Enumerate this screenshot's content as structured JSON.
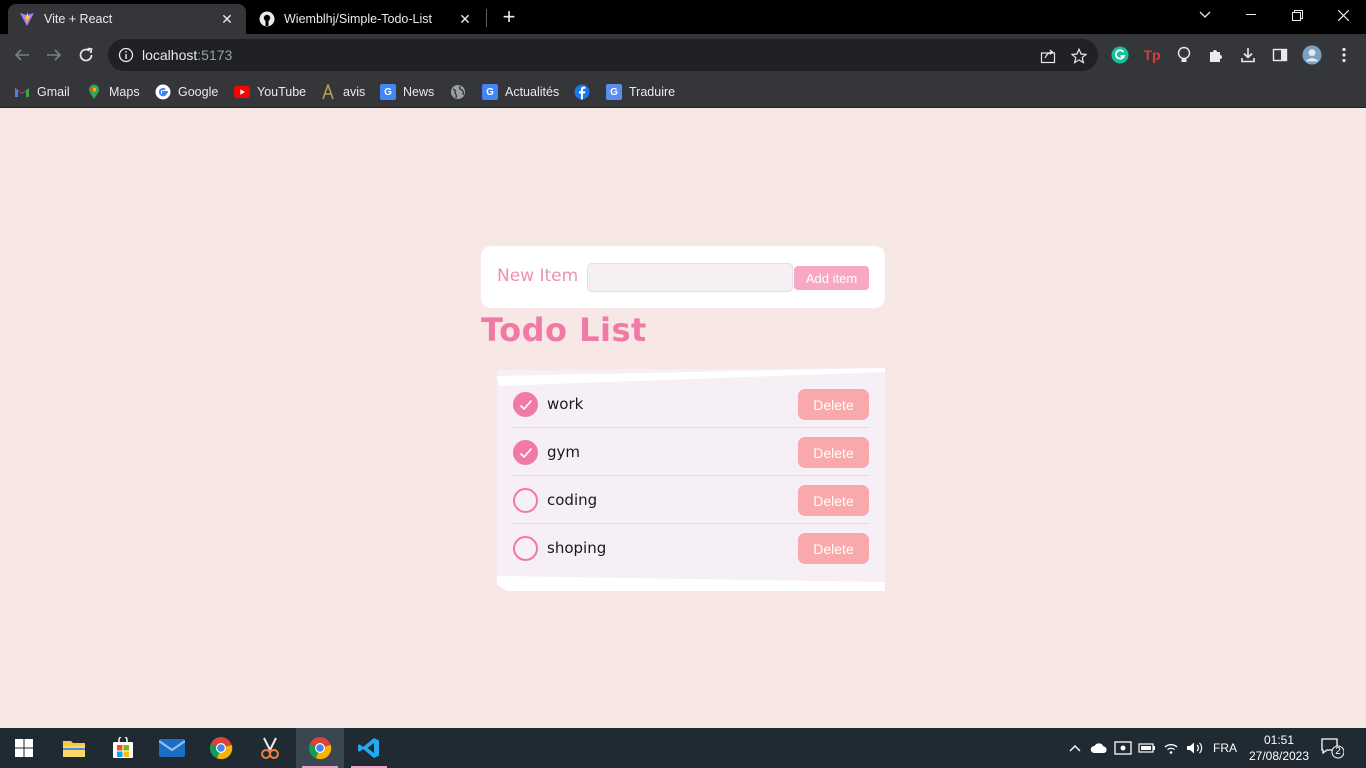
{
  "browser": {
    "tabs": [
      {
        "title": "Vite + React",
        "active": true
      },
      {
        "title": "Wiemblhj/Simple-Todo-List",
        "active": false
      }
    ],
    "url_host": "localhost",
    "url_port": ":5173",
    "bookmarks": [
      {
        "label": "Gmail",
        "icon": "gmail-icon"
      },
      {
        "label": "Maps",
        "icon": "maps-icon"
      },
      {
        "label": "Google",
        "icon": "google-icon"
      },
      {
        "label": "YouTube",
        "icon": "youtube-icon"
      },
      {
        "label": "avis",
        "icon": "avis-icon"
      },
      {
        "label": "News",
        "icon": "news-icon"
      },
      {
        "label": "",
        "icon": "globe-icon"
      },
      {
        "label": "Actualités",
        "icon": "actualites-icon"
      },
      {
        "label": "",
        "icon": "facebook-icon"
      },
      {
        "label": "Traduire",
        "icon": "translate-icon"
      }
    ]
  },
  "app": {
    "form": {
      "label": "New Item",
      "input_value": "",
      "button_label": "Add item"
    },
    "title": "Todo List",
    "items": [
      {
        "text": "work",
        "done": true,
        "delete_label": "Delete"
      },
      {
        "text": "gym",
        "done": true,
        "delete_label": "Delete"
      },
      {
        "text": "coding",
        "done": false,
        "delete_label": "Delete"
      },
      {
        "text": "shoping",
        "done": false,
        "delete_label": "Delete"
      }
    ],
    "colors": {
      "accent": "#f07aa5",
      "background": "#f7e7e5",
      "delete_button": "#f9a9ac"
    }
  },
  "taskbar": {
    "language": "FRA",
    "time": "01:51",
    "date": "27/08/2023",
    "notification_count": "2"
  }
}
